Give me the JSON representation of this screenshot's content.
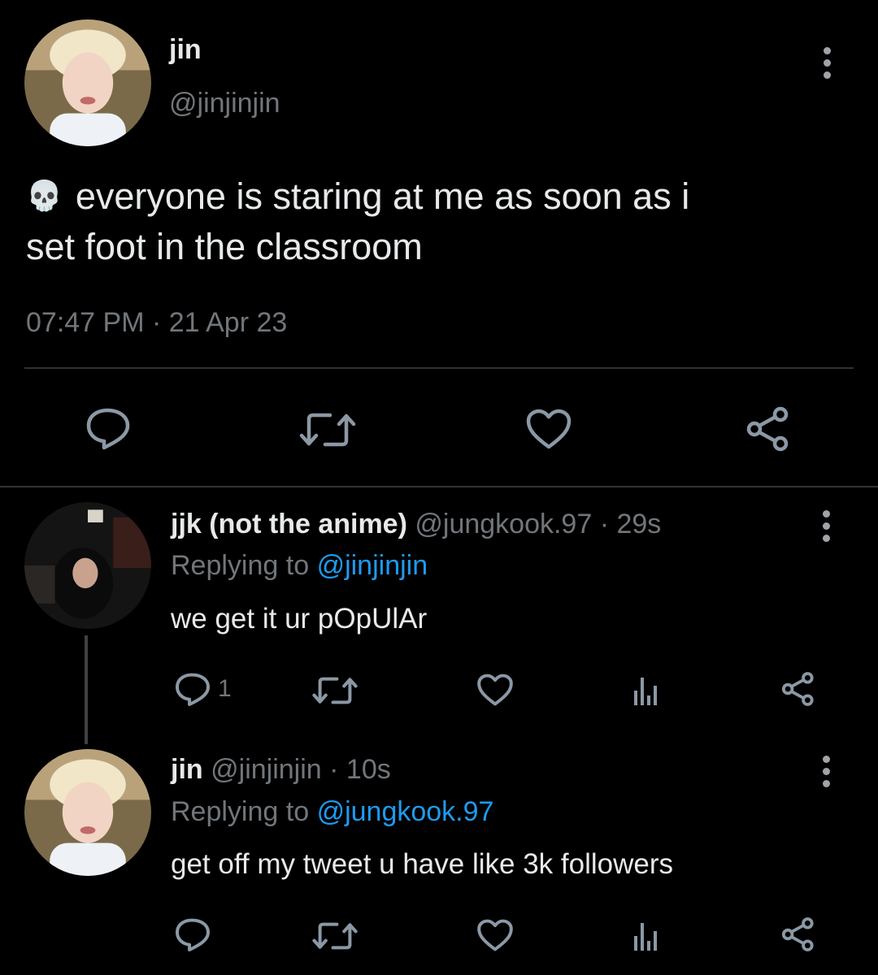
{
  "main_tweet": {
    "display_name": "jin",
    "handle": "@jinjinjin",
    "emoji": "💀",
    "text_line1": "everyone is staring at me as soon as i",
    "text_line2": "set foot in the classroom",
    "timestamp": "07:47 PM · 21 Apr 23",
    "icons": [
      "reply-icon",
      "retweet-icon",
      "like-icon",
      "share-icon"
    ]
  },
  "replies": [
    {
      "display_name": "jjk (not the anime)",
      "handle": "@jungkook.97",
      "time": "· 29s",
      "replying_label": "Replying to",
      "replying_to": "@jinjinjin",
      "text": "we get it ur pOpUlAr",
      "reply_count": "1"
    },
    {
      "display_name": "jin",
      "handle": "@jinjinjin",
      "time": "· 10s",
      "replying_label": "Replying to",
      "replying_to": "@jungkook.97",
      "text": "get off my tweet u have like 3k followers",
      "reply_count": ""
    }
  ],
  "colors": {
    "background": "#000000",
    "text": "#e7e9ea",
    "muted": "#71767b",
    "link": "#1d9bf0",
    "divider": "#2f3336"
  }
}
